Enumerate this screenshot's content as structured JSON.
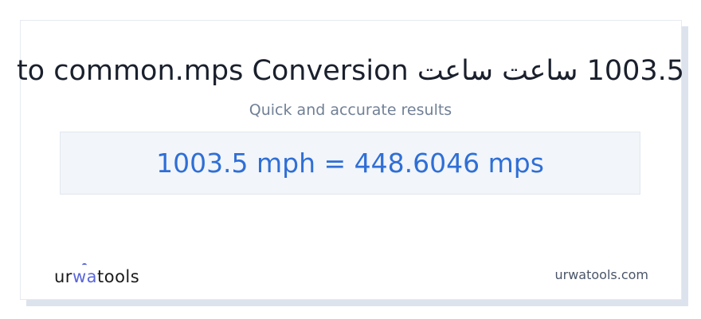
{
  "title": "1003.5 ساعت ساعت to common.mps Conversion",
  "subtitle": "Quick and accurate results",
  "result": "1003.5 mph = 448.6046 mps",
  "logo": {
    "part1": "ur",
    "part2": "wa",
    "part3": "tools"
  },
  "site": "urwatools.com",
  "colors": {
    "result_text": "#2f6fd6",
    "logo_accent": "#5a67d8",
    "result_bg": "#f2f5f9"
  }
}
